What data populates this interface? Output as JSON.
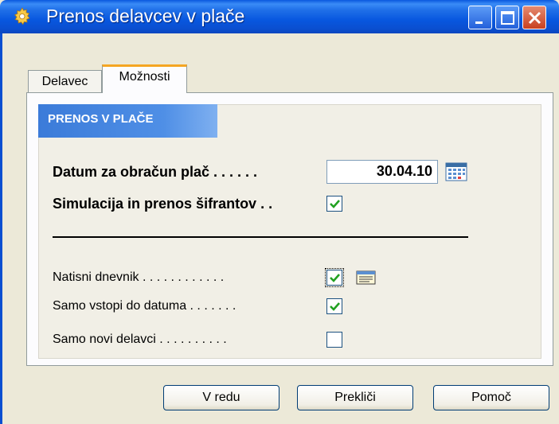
{
  "window": {
    "title": "Prenos delavcev v plače",
    "gear_icon": "gear-icon",
    "controls": [
      "minimize-icon",
      "maximize-icon",
      "close-icon"
    ]
  },
  "tabs": [
    {
      "label": "Delavec",
      "active": false
    },
    {
      "label": "Možnosti",
      "active": true
    }
  ],
  "section": {
    "header": "PRENOS V PLAČE"
  },
  "fields": {
    "date_label": "Datum za obračun plač . . . . . .",
    "date_value": "30.04.10",
    "simulation_label": "Simulacija in prenos šifrantov . .",
    "simulation_checked": true
  },
  "options": [
    {
      "label": "Natisni dnevnik . . . . . . . . . . . .",
      "checked": true,
      "focused": true,
      "icon": "report-icon"
    },
    {
      "label": "Samo vstopi do datuma . . . . . . .",
      "checked": true,
      "focused": false
    },
    {
      "label": "Samo novi delavci . . . . . . . . . .",
      "checked": false,
      "focused": false
    }
  ],
  "buttons": {
    "ok": "V redu",
    "cancel": "Prekliči",
    "help": "Pomoč"
  },
  "colors": {
    "titlebar": "#0a58de",
    "section_header": "#3b7bd9",
    "active_tab_accent": "#f5a623",
    "check": "#21a121"
  }
}
